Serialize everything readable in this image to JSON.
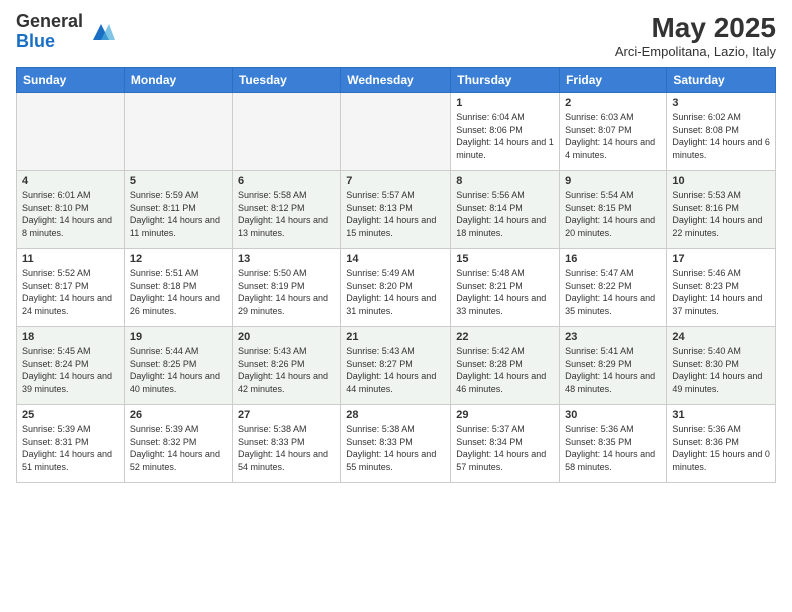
{
  "logo": {
    "general": "General",
    "blue": "Blue"
  },
  "title": "May 2025",
  "subtitle": "Arci-Empolitana, Lazio, Italy",
  "days_header": [
    "Sunday",
    "Monday",
    "Tuesday",
    "Wednesday",
    "Thursday",
    "Friday",
    "Saturday"
  ],
  "weeks": [
    [
      {
        "day": "",
        "info": ""
      },
      {
        "day": "",
        "info": ""
      },
      {
        "day": "",
        "info": ""
      },
      {
        "day": "",
        "info": ""
      },
      {
        "day": "1",
        "info": "Sunrise: 6:04 AM\nSunset: 8:06 PM\nDaylight: 14 hours and 1 minute."
      },
      {
        "day": "2",
        "info": "Sunrise: 6:03 AM\nSunset: 8:07 PM\nDaylight: 14 hours and 4 minutes."
      },
      {
        "day": "3",
        "info": "Sunrise: 6:02 AM\nSunset: 8:08 PM\nDaylight: 14 hours and 6 minutes."
      }
    ],
    [
      {
        "day": "4",
        "info": "Sunrise: 6:01 AM\nSunset: 8:10 PM\nDaylight: 14 hours and 8 minutes."
      },
      {
        "day": "5",
        "info": "Sunrise: 5:59 AM\nSunset: 8:11 PM\nDaylight: 14 hours and 11 minutes."
      },
      {
        "day": "6",
        "info": "Sunrise: 5:58 AM\nSunset: 8:12 PM\nDaylight: 14 hours and 13 minutes."
      },
      {
        "day": "7",
        "info": "Sunrise: 5:57 AM\nSunset: 8:13 PM\nDaylight: 14 hours and 15 minutes."
      },
      {
        "day": "8",
        "info": "Sunrise: 5:56 AM\nSunset: 8:14 PM\nDaylight: 14 hours and 18 minutes."
      },
      {
        "day": "9",
        "info": "Sunrise: 5:54 AM\nSunset: 8:15 PM\nDaylight: 14 hours and 20 minutes."
      },
      {
        "day": "10",
        "info": "Sunrise: 5:53 AM\nSunset: 8:16 PM\nDaylight: 14 hours and 22 minutes."
      }
    ],
    [
      {
        "day": "11",
        "info": "Sunrise: 5:52 AM\nSunset: 8:17 PM\nDaylight: 14 hours and 24 minutes."
      },
      {
        "day": "12",
        "info": "Sunrise: 5:51 AM\nSunset: 8:18 PM\nDaylight: 14 hours and 26 minutes."
      },
      {
        "day": "13",
        "info": "Sunrise: 5:50 AM\nSunset: 8:19 PM\nDaylight: 14 hours and 29 minutes."
      },
      {
        "day": "14",
        "info": "Sunrise: 5:49 AM\nSunset: 8:20 PM\nDaylight: 14 hours and 31 minutes."
      },
      {
        "day": "15",
        "info": "Sunrise: 5:48 AM\nSunset: 8:21 PM\nDaylight: 14 hours and 33 minutes."
      },
      {
        "day": "16",
        "info": "Sunrise: 5:47 AM\nSunset: 8:22 PM\nDaylight: 14 hours and 35 minutes."
      },
      {
        "day": "17",
        "info": "Sunrise: 5:46 AM\nSunset: 8:23 PM\nDaylight: 14 hours and 37 minutes."
      }
    ],
    [
      {
        "day": "18",
        "info": "Sunrise: 5:45 AM\nSunset: 8:24 PM\nDaylight: 14 hours and 39 minutes."
      },
      {
        "day": "19",
        "info": "Sunrise: 5:44 AM\nSunset: 8:25 PM\nDaylight: 14 hours and 40 minutes."
      },
      {
        "day": "20",
        "info": "Sunrise: 5:43 AM\nSunset: 8:26 PM\nDaylight: 14 hours and 42 minutes."
      },
      {
        "day": "21",
        "info": "Sunrise: 5:43 AM\nSunset: 8:27 PM\nDaylight: 14 hours and 44 minutes."
      },
      {
        "day": "22",
        "info": "Sunrise: 5:42 AM\nSunset: 8:28 PM\nDaylight: 14 hours and 46 minutes."
      },
      {
        "day": "23",
        "info": "Sunrise: 5:41 AM\nSunset: 8:29 PM\nDaylight: 14 hours and 48 minutes."
      },
      {
        "day": "24",
        "info": "Sunrise: 5:40 AM\nSunset: 8:30 PM\nDaylight: 14 hours and 49 minutes."
      }
    ],
    [
      {
        "day": "25",
        "info": "Sunrise: 5:39 AM\nSunset: 8:31 PM\nDaylight: 14 hours and 51 minutes."
      },
      {
        "day": "26",
        "info": "Sunrise: 5:39 AM\nSunset: 8:32 PM\nDaylight: 14 hours and 52 minutes."
      },
      {
        "day": "27",
        "info": "Sunrise: 5:38 AM\nSunset: 8:33 PM\nDaylight: 14 hours and 54 minutes."
      },
      {
        "day": "28",
        "info": "Sunrise: 5:38 AM\nSunset: 8:33 PM\nDaylight: 14 hours and 55 minutes."
      },
      {
        "day": "29",
        "info": "Sunrise: 5:37 AM\nSunset: 8:34 PM\nDaylight: 14 hours and 57 minutes."
      },
      {
        "day": "30",
        "info": "Sunrise: 5:36 AM\nSunset: 8:35 PM\nDaylight: 14 hours and 58 minutes."
      },
      {
        "day": "31",
        "info": "Sunrise: 5:36 AM\nSunset: 8:36 PM\nDaylight: 15 hours and 0 minutes."
      }
    ]
  ]
}
